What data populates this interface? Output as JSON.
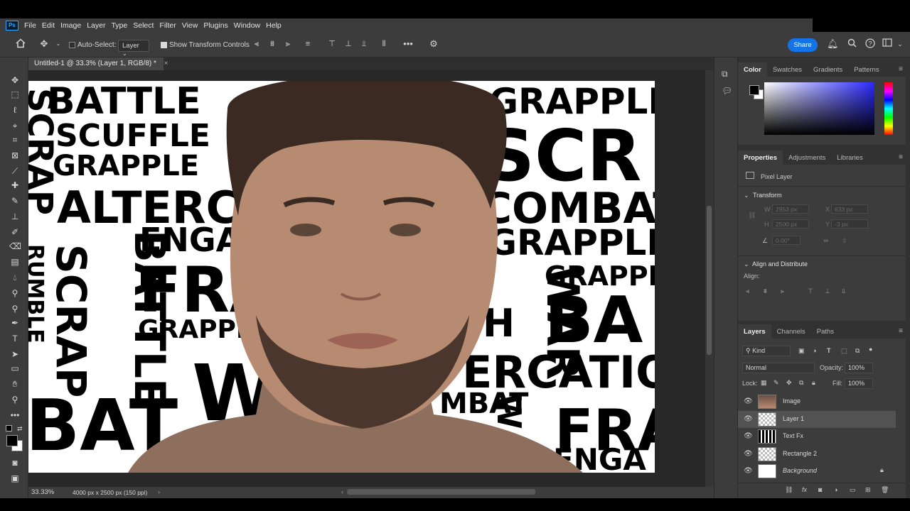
{
  "app": {
    "logo": "Ps"
  },
  "menu": [
    "File",
    "Edit",
    "Image",
    "Layer",
    "Type",
    "Select",
    "Filter",
    "View",
    "Plugins",
    "Window",
    "Help"
  ],
  "options": {
    "auto_select_label": "Auto-Select:",
    "auto_select_checked": false,
    "layer_select_value": "Layer",
    "show_transform_label": "Show Transform Controls",
    "show_transform_checked": true,
    "more_label": "•••",
    "share_label": "Share"
  },
  "document": {
    "tab_title": "Untitled-1 @ 33.3% (Layer 1, RGB/8) *",
    "close": "×",
    "zoom": "33.33%",
    "dimensions": "4000 px x 2500 px (150 ppi)"
  },
  "canvas_words": {
    "left": [
      "BATTLE",
      "SCUFFLE",
      "GRAPPLE",
      "ALTERC",
      "ENGA",
      "FRA",
      "GRAPPL",
      "WAR",
      "BAT"
    ],
    "left_vertical": [
      "SCRAP",
      "SCRAP",
      "BATTLE",
      "RUMBLE"
    ],
    "right": [
      "GRAPPLE",
      "SCR",
      "COMBAT",
      "GRAPPLE",
      "GRAPPL",
      "BA",
      "ERCATIO",
      "MBAT",
      "FRA",
      "ENGA"
    ],
    "right_vertical": [
      "WAR",
      "WAR",
      "SH"
    ]
  },
  "color_panel": {
    "tabs": [
      "Color",
      "Swatches",
      "Gradients",
      "Patterns"
    ],
    "foreground": "#000000",
    "background": "#ffffff",
    "hue": "#2a2aff"
  },
  "properties_panel": {
    "tabs": [
      "Properties",
      "Adjustments",
      "Libraries"
    ],
    "layer_kind": "Pixel Layer",
    "transform_title": "Transform",
    "w_label": "W",
    "w_value": "2953 px",
    "x_label": "X",
    "x_value": "633 px",
    "h_label": "H",
    "h_value": "2500 px",
    "y_label": "Y",
    "y_value": "-3 px",
    "angle_value": "0.00°",
    "align_title": "Align and Distribute",
    "align_label": "Align:"
  },
  "layers_panel": {
    "tabs": [
      "Layers",
      "Channels",
      "Paths"
    ],
    "filter_kind": "Kind",
    "blend_mode": "Normal",
    "opacity_label": "Opacity:",
    "opacity_value": "100%",
    "lock_label": "Lock:",
    "fill_label": "Fill:",
    "fill_value": "100%",
    "layers": [
      {
        "name": "Image",
        "selected": false
      },
      {
        "name": "Layer 1",
        "selected": true
      },
      {
        "name": "Text Fx",
        "selected": false
      },
      {
        "name": "Rectangle 2",
        "selected": false
      },
      {
        "name": "Background",
        "selected": false
      }
    ]
  }
}
